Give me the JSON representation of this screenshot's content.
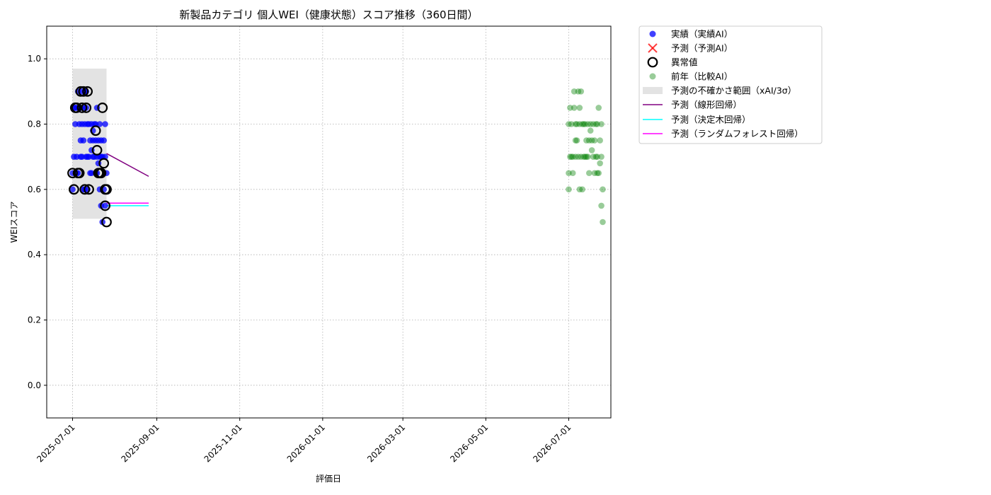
{
  "chart_data": {
    "type": "scatter",
    "title": "新製品カテゴリ 個人WEI（健康状態）スコア推移（360日間）",
    "xlabel": "評価日",
    "ylabel": "WEIスコア",
    "xlim": [
      "2025-06-12",
      "2026-08-01"
    ],
    "ylim": [
      -0.1,
      1.1
    ],
    "x_ticks": [
      "2025-07-01",
      "2025-09-01",
      "2025-11-01",
      "2026-01-01",
      "2026-03-01",
      "2026-05-01",
      "2026-07-01"
    ],
    "y_ticks": [
      0.0,
      0.2,
      0.4,
      0.6,
      0.8,
      1.0
    ],
    "y_tick_labels": [
      "0.0",
      "0.2",
      "0.4",
      "0.6",
      "0.8",
      "1.0"
    ],
    "grid": true,
    "legend_position": "outside-top-right",
    "colors": {
      "actual": "#0000ff",
      "predicted": "#ff0000",
      "anomaly": "#000000",
      "previous": "#008000",
      "band": "#cccccc",
      "linear": "#800080",
      "tree": "#00ffff",
      "forest": "#ff00ff"
    },
    "legend": [
      {
        "key": "actual",
        "label": "実績（実績AI）",
        "marker": "dot"
      },
      {
        "key": "predicted",
        "label": "予測（予測AI）",
        "marker": "x"
      },
      {
        "key": "anomaly",
        "label": "異常値",
        "marker": "ring"
      },
      {
        "key": "previous",
        "label": "前年（比較AI）",
        "marker": "dot-light"
      },
      {
        "key": "band",
        "label": "予測の不確かさ範囲（xAI/3σ）",
        "marker": "rect"
      },
      {
        "key": "linear",
        "label": "予測（線形回帰）",
        "marker": "line"
      },
      {
        "key": "tree",
        "label": "予測（決定木回帰）",
        "marker": "line"
      },
      {
        "key": "forest",
        "label": "予測（ランダムフォレスト回帰）",
        "marker": "line"
      }
    ],
    "actual": {
      "dates": [
        "2025-07-01",
        "2025-07-01",
        "2025-07-02",
        "2025-07-02",
        "2025-07-03",
        "2025-07-03",
        "2025-07-04",
        "2025-07-04",
        "2025-07-04",
        "2025-07-05",
        "2025-07-05",
        "2025-07-06",
        "2025-07-06",
        "2025-07-07",
        "2025-07-07",
        "2025-07-07",
        "2025-07-08",
        "2025-07-08",
        "2025-07-08",
        "2025-07-09",
        "2025-07-09",
        "2025-07-09",
        "2025-07-10",
        "2025-07-10",
        "2025-07-10",
        "2025-07-11",
        "2025-07-11",
        "2025-07-11",
        "2025-07-12",
        "2025-07-12",
        "2025-07-12",
        "2025-07-13",
        "2025-07-13",
        "2025-07-14",
        "2025-07-14",
        "2025-07-15",
        "2025-07-15",
        "2025-07-15",
        "2025-07-16",
        "2025-07-16",
        "2025-07-16",
        "2025-07-17",
        "2025-07-17",
        "2025-07-18",
        "2025-07-18",
        "2025-07-18",
        "2025-07-19",
        "2025-07-19",
        "2025-07-19",
        "2025-07-20",
        "2025-07-20",
        "2025-07-21",
        "2025-07-21",
        "2025-07-21",
        "2025-07-22",
        "2025-07-22",
        "2025-07-22",
        "2025-07-23",
        "2025-07-23",
        "2025-07-24",
        "2025-07-24",
        "2025-07-25",
        "2025-07-25",
        "2025-07-25",
        "2025-07-26"
      ],
      "values": [
        0.65,
        0.6,
        0.7,
        0.85,
        0.8,
        0.85,
        0.65,
        0.7,
        0.85,
        0.9,
        0.65,
        0.8,
        0.85,
        0.7,
        0.75,
        0.85,
        0.9,
        0.8,
        0.7,
        0.75,
        0.85,
        0.6,
        0.6,
        0.8,
        0.9,
        0.7,
        0.85,
        0.9,
        0.7,
        0.8,
        0.6,
        0.8,
        0.7,
        0.65,
        0.75,
        0.8,
        0.72,
        0.65,
        0.78,
        0.75,
        0.7,
        0.8,
        0.7,
        0.65,
        0.75,
        0.8,
        0.65,
        0.7,
        0.85,
        0.75,
        0.68,
        0.8,
        0.7,
        0.6,
        0.75,
        0.55,
        0.7,
        0.7,
        0.5,
        0.75,
        0.6,
        0.7,
        0.8,
        0.55,
        0.65
      ]
    },
    "anomalies": {
      "dates": [
        "2025-07-01",
        "2025-07-02",
        "2025-07-03",
        "2025-07-04",
        "2025-07-05",
        "2025-07-06",
        "2025-07-07",
        "2025-07-08",
        "2025-07-09",
        "2025-07-10",
        "2025-07-11",
        "2025-07-12",
        "2025-07-13",
        "2025-07-18",
        "2025-07-19",
        "2025-07-20",
        "2025-07-21",
        "2025-07-22",
        "2025-07-23",
        "2025-07-24",
        "2025-07-25",
        "2025-07-25",
        "2025-07-26",
        "2025-07-26"
      ],
      "values": [
        0.65,
        0.6,
        0.85,
        0.85,
        0.65,
        0.65,
        0.9,
        0.85,
        0.9,
        0.6,
        0.85,
        0.9,
        0.6,
        0.78,
        0.72,
        0.65,
        0.65,
        0.65,
        0.85,
        0.68,
        0.55,
        0.6,
        0.5,
        0.6
      ]
    },
    "previous": {
      "dates": [
        "2026-07-01",
        "2026-07-01",
        "2026-07-01",
        "2026-07-02",
        "2026-07-02",
        "2026-07-03",
        "2026-07-03",
        "2026-07-04",
        "2026-07-04",
        "2026-07-05",
        "2026-07-05",
        "2026-07-06",
        "2026-07-06",
        "2026-07-06",
        "2026-07-07",
        "2026-07-07",
        "2026-07-08",
        "2026-07-08",
        "2026-07-09",
        "2026-07-09",
        "2026-07-09",
        "2026-07-10",
        "2026-07-10",
        "2026-07-11",
        "2026-07-11",
        "2026-07-12",
        "2026-07-12",
        "2026-07-13",
        "2026-07-13",
        "2026-07-14",
        "2026-07-14",
        "2026-07-15",
        "2026-07-15",
        "2026-07-16",
        "2026-07-16",
        "2026-07-17",
        "2026-07-17",
        "2026-07-18",
        "2026-07-18",
        "2026-07-19",
        "2026-07-19",
        "2026-07-20",
        "2026-07-20",
        "2026-07-21",
        "2026-07-21",
        "2026-07-22",
        "2026-07-22",
        "2026-07-22",
        "2026-07-23",
        "2026-07-23",
        "2026-07-24",
        "2026-07-24",
        "2026-07-25",
        "2026-07-25",
        "2026-07-25",
        "2026-07-26",
        "2026-07-26"
      ],
      "values": [
        0.65,
        0.6,
        0.8,
        0.7,
        0.85,
        0.7,
        0.8,
        0.65,
        0.7,
        0.85,
        0.9,
        0.8,
        0.75,
        0.7,
        0.8,
        0.75,
        0.7,
        0.9,
        0.85,
        0.8,
        0.6,
        0.7,
        0.9,
        0.8,
        0.6,
        0.7,
        0.8,
        0.8,
        0.7,
        0.75,
        0.7,
        0.8,
        0.7,
        0.75,
        0.65,
        0.8,
        0.78,
        0.75,
        0.72,
        0.7,
        0.8,
        0.65,
        0.75,
        0.7,
        0.8,
        0.65,
        0.7,
        0.8,
        0.65,
        0.85,
        0.68,
        0.75,
        0.7,
        0.55,
        0.8,
        0.6,
        0.5
      ]
    },
    "uncertainty_band": {
      "x": [
        "2025-07-01",
        "2025-07-26"
      ],
      "y": [
        0.51,
        0.97
      ]
    },
    "prediction_lines": [
      {
        "key": "linear",
        "x": [
          "2025-07-26",
          "2025-08-26"
        ],
        "y": [
          0.71,
          0.64
        ]
      },
      {
        "key": "tree",
        "x": [
          "2025-07-26",
          "2025-08-26"
        ],
        "y": [
          0.55,
          0.55
        ]
      },
      {
        "key": "forest",
        "x": [
          "2025-07-26",
          "2025-08-26"
        ],
        "y": [
          0.558,
          0.558
        ]
      }
    ]
  }
}
